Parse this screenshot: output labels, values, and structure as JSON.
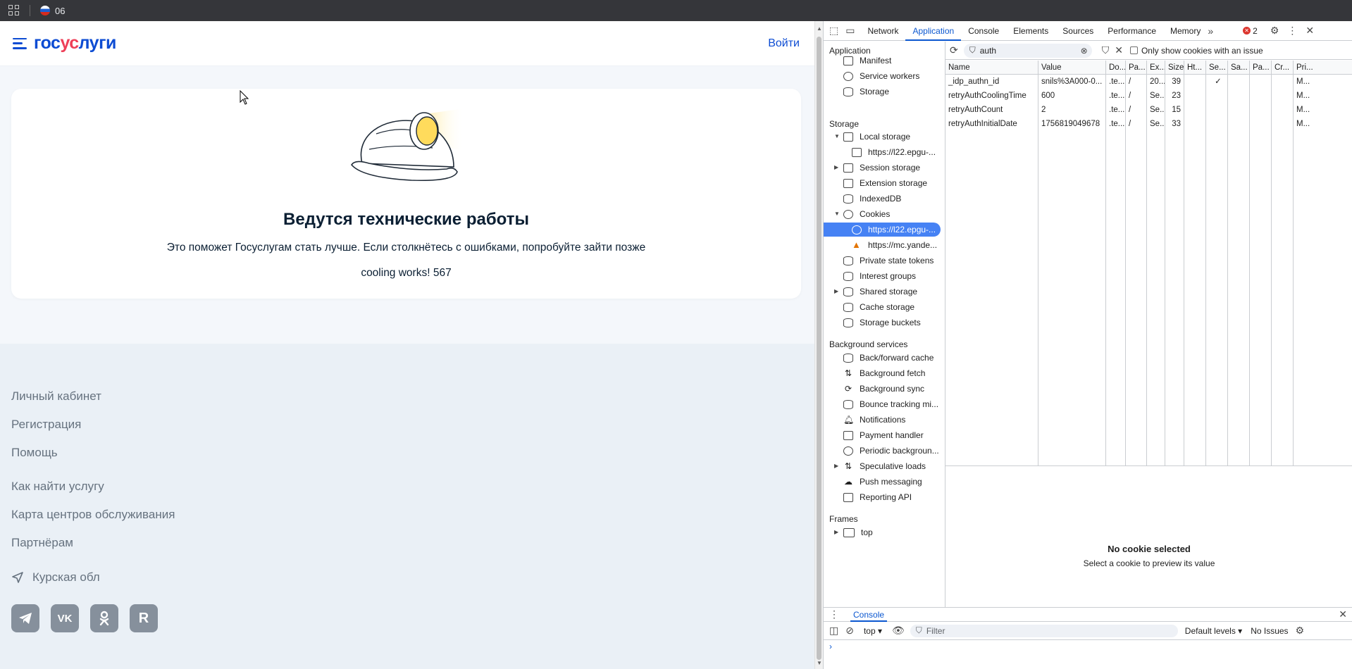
{
  "topbar": {
    "tab_count": "06"
  },
  "site": {
    "logo_blue_1": "гос",
    "logo_red": "ус",
    "logo_blue_2": "луги",
    "login": "Войти",
    "title": "Ведутся технические работы",
    "subtitle": "Это поможет Госуслугам стать лучше. Если столкнётесь с ошибками, попробуйте зайти позже",
    "cooling": "cooling works! 567",
    "footer_links": [
      "Личный кабинет",
      "Регистрация",
      "Помощь",
      "Как найти услугу",
      "Карта центров обслуживания",
      "Партнёрам"
    ],
    "region": "Курская обл",
    "socials": [
      "telegram-icon",
      "vk-icon",
      "ok-icon",
      "rutube-icon"
    ]
  },
  "devtools": {
    "tabs": [
      "Network",
      "Application",
      "Console",
      "Elements",
      "Sources",
      "Performance",
      "Memory"
    ],
    "error_count": "2",
    "sidebar": {
      "application_header": "Application",
      "application_items": [
        "Manifest",
        "Service workers",
        "Storage"
      ],
      "storage_header": "Storage",
      "storage_items": [
        "Local storage",
        "https://l22.epgu-...",
        "Session storage",
        "Extension storage",
        "IndexedDB",
        "Cookies",
        "https://l22.epgu-...",
        "https://mc.yande...",
        "Private state tokens",
        "Interest groups",
        "Shared storage",
        "Cache storage",
        "Storage buckets"
      ],
      "bg_header": "Background services",
      "bg_items": [
        "Back/forward cache",
        "Background fetch",
        "Background sync",
        "Bounce tracking mi...",
        "Notifications",
        "Payment handler",
        "Periodic backgroun...",
        "Speculative loads",
        "Push messaging",
        "Reporting API"
      ],
      "frames_header": "Frames",
      "frames_items": [
        "top"
      ]
    },
    "filter_value": "auth",
    "only_issue": "Only show cookies with an issue",
    "columns": [
      "Name",
      "Value",
      "Do...",
      "Pa...",
      "Ex...",
      "Size",
      "Ht...",
      "Se...",
      "Sa...",
      "Pa...",
      "Cr...",
      "Pri..."
    ],
    "rows": [
      [
        "_idp_authn_id",
        "snils%3A000-0...",
        ".te...",
        "/",
        "20...",
        "39",
        "",
        "✓",
        "",
        "",
        "",
        "M..."
      ],
      [
        "retryAuthCoolingTime",
        "600",
        ".te...",
        "/",
        "Se...",
        "23",
        "",
        "",
        "",
        "",
        "",
        "M..."
      ],
      [
        "retryAuthCount",
        "2",
        ".te...",
        "/",
        "Se...",
        "15",
        "",
        "",
        "",
        "",
        "",
        "M..."
      ],
      [
        "retryAuthInitialDate",
        "1756819049678",
        ".te...",
        "/",
        "Se...",
        "33",
        "",
        "",
        "",
        "",
        "",
        "M..."
      ]
    ],
    "preview_title": "No cookie selected",
    "preview_sub": "Select a cookie to preview its value",
    "drawer_tab": "Console",
    "context": "top",
    "console_filter": "Filter",
    "levels": "Default levels",
    "issues": "No Issues"
  }
}
